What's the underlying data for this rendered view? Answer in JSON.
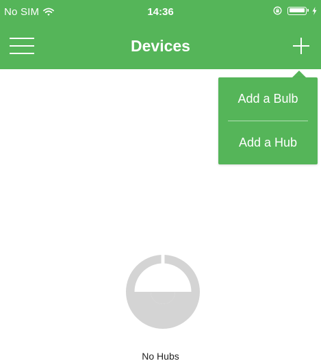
{
  "status_bar": {
    "carrier": "No SIM",
    "time": "14:36"
  },
  "nav": {
    "title": "Devices"
  },
  "add_menu": {
    "items": [
      {
        "label": "Add a Bulb"
      },
      {
        "label": "Add a Hub"
      }
    ]
  },
  "empty_state": {
    "label": "No Hubs"
  },
  "colors": {
    "primary": "#55b559",
    "empty_icon": "#d4d4d4",
    "text": "#222222"
  },
  "icons": {
    "menu": "hamburger-icon",
    "add": "plus-icon",
    "wifi": "wifi-icon",
    "battery": "battery-icon",
    "empty": "hub-icon"
  }
}
